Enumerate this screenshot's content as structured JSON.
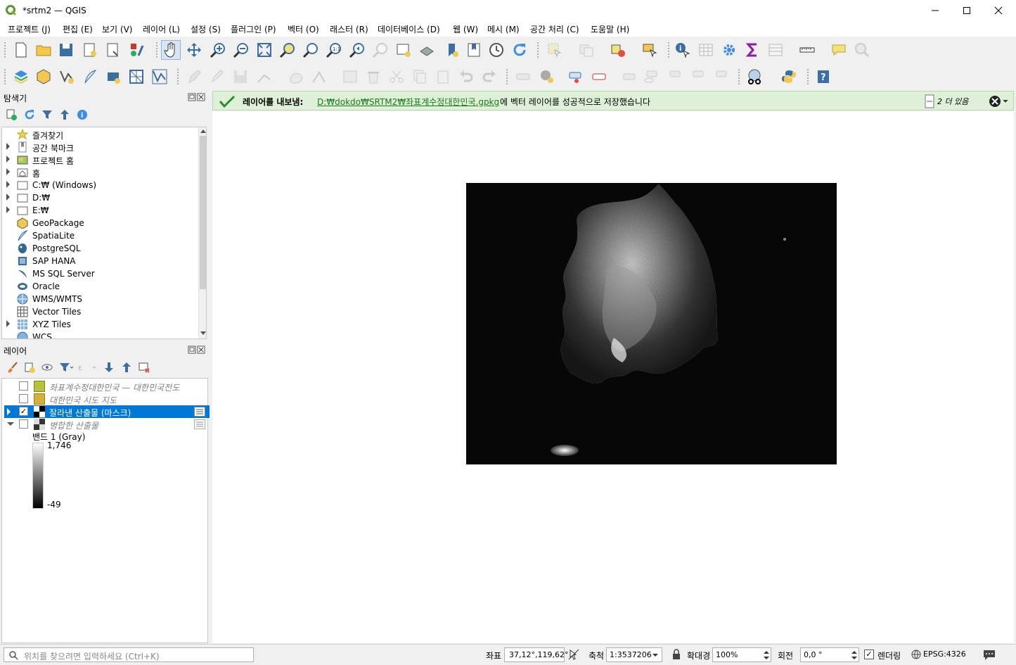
{
  "window": {
    "title": "*srtm2 — QGIS"
  },
  "menu": [
    "프로젝트 (J)",
    "편집 (E)",
    "보기 (V)",
    "레이어 (L)",
    "설정 (S)",
    "플러그인 (P)",
    "벡터 (O)",
    "래스터 (R)",
    "데이터베이스 (D)",
    "웹 (W)",
    "메시 (M)",
    "공간 처리 (C)",
    "도움말 (H)"
  ],
  "browser_panel": {
    "title": "탐색기",
    "items": [
      {
        "label": "즐겨찾기",
        "icon": "star-icon",
        "expandable": false
      },
      {
        "label": "공간 북마크",
        "icon": "bookmark-icon",
        "expandable": true
      },
      {
        "label": "프로젝트 홈",
        "icon": "project-home-icon",
        "expandable": true
      },
      {
        "label": "홈",
        "icon": "home-folder-icon",
        "expandable": true
      },
      {
        "label": "C:₩ (Windows)",
        "icon": "folder-icon",
        "expandable": true
      },
      {
        "label": "D:₩",
        "icon": "folder-icon",
        "expandable": true
      },
      {
        "label": "E:₩",
        "icon": "folder-icon",
        "expandable": true
      },
      {
        "label": "GeoPackage",
        "icon": "geopackage-icon",
        "expandable": false
      },
      {
        "label": "SpatiaLite",
        "icon": "spatialite-icon",
        "expandable": false
      },
      {
        "label": "PostgreSQL",
        "icon": "postgresql-icon",
        "expandable": false
      },
      {
        "label": "SAP HANA",
        "icon": "sap-hana-icon",
        "expandable": false
      },
      {
        "label": "MS SQL Server",
        "icon": "mssql-icon",
        "expandable": false
      },
      {
        "label": "Oracle",
        "icon": "oracle-icon",
        "expandable": false
      },
      {
        "label": "WMS/WMTS",
        "icon": "wms-icon",
        "expandable": false
      },
      {
        "label": "Vector Tiles",
        "icon": "vector-tiles-icon",
        "expandable": false
      },
      {
        "label": "XYZ Tiles",
        "icon": "xyz-tiles-icon",
        "expandable": true
      },
      {
        "label": "WCS",
        "icon": "wcs-icon",
        "expandable": false
      }
    ]
  },
  "layers_panel": {
    "title": "레이어",
    "layers": [
      {
        "name": "좌표계수정대한민국 — 대한민국전도",
        "checked": false,
        "color": "#b5c23a",
        "italic": true,
        "selected": false
      },
      {
        "name": "대한민국 시도 지도",
        "checked": false,
        "color": "#d4b23a",
        "italic": true,
        "selected": false
      },
      {
        "name": "잘라낸 산출물 (마스크)",
        "checked": true,
        "color": "raster",
        "italic": false,
        "selected": true
      },
      {
        "name": "병합한 산출물",
        "checked": false,
        "color": "raster",
        "italic": true,
        "selected": false
      }
    ],
    "legend": {
      "band": "밴드 1 (Gray)",
      "max": "1,746",
      "min": "-49"
    }
  },
  "message_bar": {
    "prefix": "레이어를 내보냄:",
    "link": "D:₩dokdo₩SRTM2₩좌표계수정대한민국.gpkg",
    "suffix": "에 벡터 레이어를 성공적으로 저장했습니다",
    "more": "2 더 있음",
    "color": "#dff0d8"
  },
  "statusbar": {
    "search_placeholder": "위치를 찾으려면 입력하세요 (Ctrl+K)",
    "coord_label": "좌표",
    "coord_value": "37,12°,119,62°",
    "scale_label": "축척",
    "scale_value": "1:3537206",
    "magnifier_label": "확대경",
    "magnifier_value": "100%",
    "rotation_label": "회전",
    "rotation_value": "0,0 °",
    "render_label": "렌더링",
    "crs": "EPSG:4326"
  }
}
